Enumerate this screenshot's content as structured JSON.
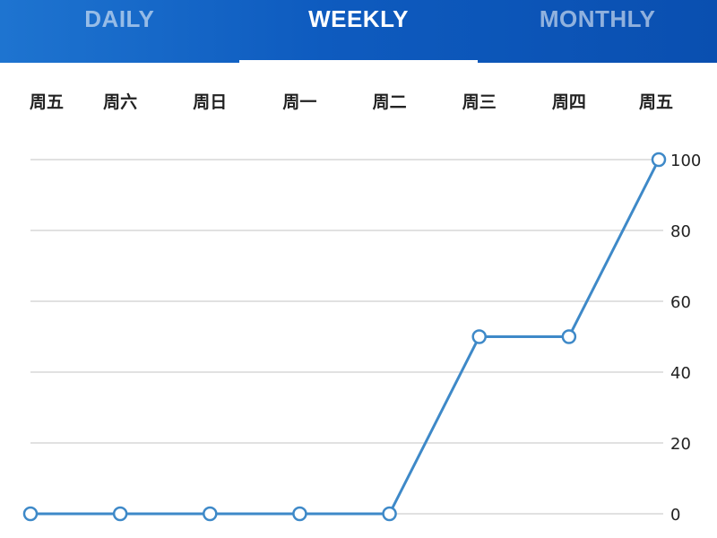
{
  "tabs": [
    {
      "label": "DAILY",
      "active": false
    },
    {
      "label": "WEEKLY",
      "active": true
    },
    {
      "label": "MONTHLY",
      "active": false
    }
  ],
  "colors": {
    "tab_active": "#ffffff",
    "tab_inactive": "rgba(255,255,255,0.55)",
    "line": "#3e89c8",
    "grid": "#cfcfcf",
    "text": "#222222"
  },
  "chart_data": {
    "type": "line",
    "categories": [
      "周五",
      "周六",
      "周日",
      "周一",
      "周二",
      "周三",
      "周四",
      "周五"
    ],
    "values": [
      0,
      0,
      0,
      0,
      0,
      50,
      50,
      100
    ],
    "title": "",
    "xlabel": "",
    "ylabel": "",
    "ylim": [
      0,
      100
    ],
    "yticks": [
      0,
      20,
      40,
      60,
      80,
      100
    ],
    "grid": true,
    "y_axis_side": "right",
    "x_labels_position": "top"
  }
}
